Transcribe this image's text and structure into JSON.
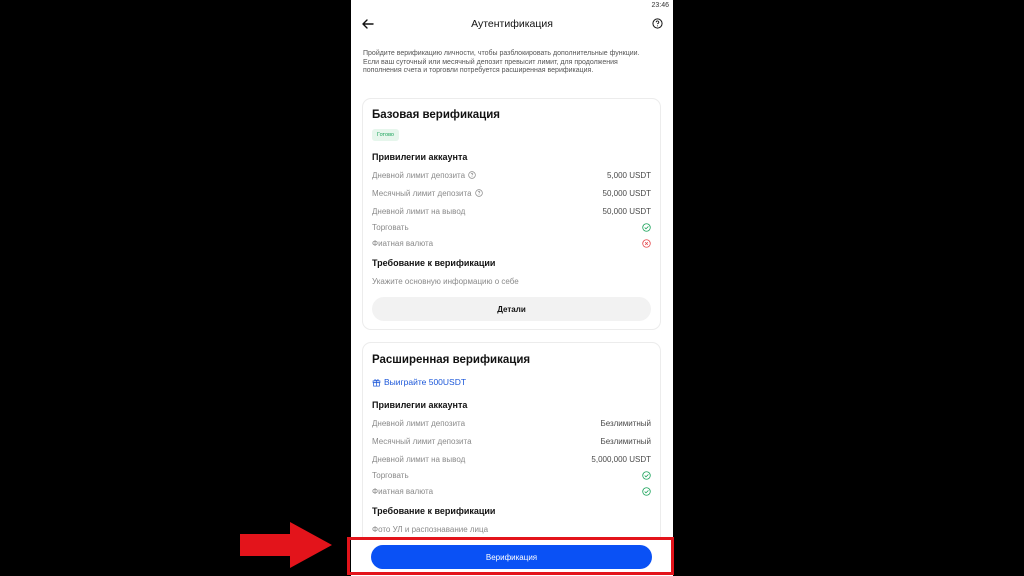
{
  "status_bar": {
    "time": "23:46"
  },
  "header": {
    "title": "Аутентификация",
    "back_icon": "arrow-left-icon",
    "help_icon": "question-circle-icon"
  },
  "intro_text": "Пройдите верификацию личности, чтобы разблокировать дополнительные функции. Если ваш суточный или месячный депозит превысит лимит, для продолжения пополнения счета и торговли потребуется расширенная верификация.",
  "basic": {
    "title": "Базовая верификация",
    "status_badge": "Готово",
    "privileges_title": "Привилегии аккаунта",
    "rows": [
      {
        "label": "Дневной лимит депозита",
        "value": "5,000 USDT",
        "has_help": true
      },
      {
        "label": "Месячный лимит депозита",
        "value": "50,000 USDT",
        "has_help": true
      },
      {
        "label": "Дневной лимит на вывод",
        "value": "50,000 USDT"
      },
      {
        "label": "Торговать",
        "status": "allowed"
      },
      {
        "label": "Фиатная валюта",
        "status": "not-allowed"
      }
    ],
    "requirement_title": "Требование к верификации",
    "requirement_text": "Укажите основную информацию о себе",
    "details_button": "Детали"
  },
  "advanced": {
    "title": "Расширенная верификация",
    "promo": "Выиграйте 500USDT",
    "privileges_title": "Привилегии аккаунта",
    "rows": [
      {
        "label": "Дневной лимит депозита",
        "value": "Безлимитный"
      },
      {
        "label": "Месячный лимит депозита",
        "value": "Безлимитный"
      },
      {
        "label": "Дневной лимит на вывод",
        "value": "5,000,000 USDT"
      },
      {
        "label": "Торговать",
        "status": "allowed"
      },
      {
        "label": "Фиатная валюта",
        "status": "allowed"
      }
    ],
    "requirement_title": "Требование к верификации",
    "requirement_text": "Фото УЛ и распознавание лица"
  },
  "primary_button": "Верификация",
  "colors": {
    "accent": "#0A51F5",
    "success": "#1AA35A",
    "error": "#E5484D",
    "annotation": "#E3141B"
  }
}
